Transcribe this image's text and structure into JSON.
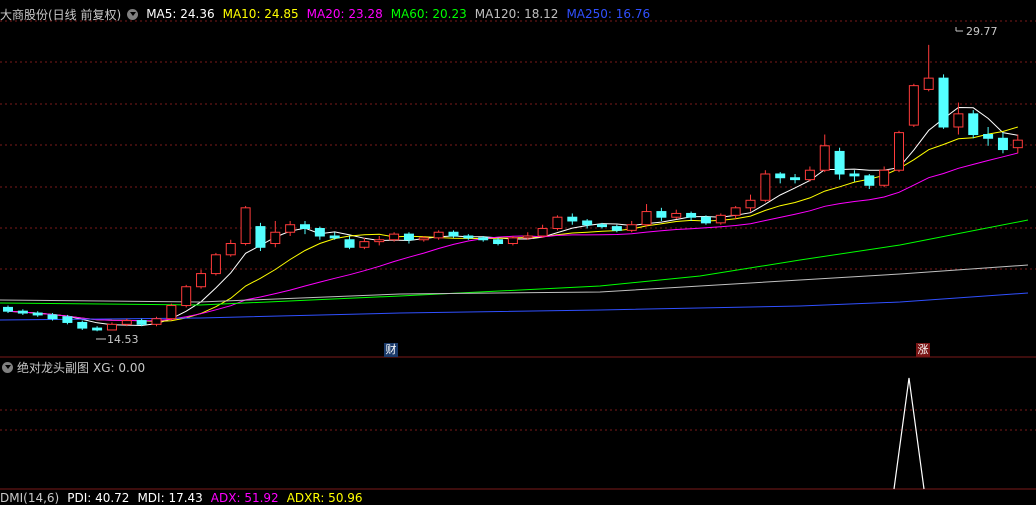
{
  "main_panel": {
    "title": "大商股份(日线 前复权)",
    "ma": [
      {
        "label": "MA5: 24.36",
        "color": "#ffffff"
      },
      {
        "label": "MA10: 24.85",
        "color": "#ffff00"
      },
      {
        "label": "MA20: 23.28",
        "color": "#ff00ff"
      },
      {
        "label": "MA60: 20.23",
        "color": "#00ff00"
      },
      {
        "label": "MA120: 18.12",
        "color": "#c0c0c0"
      },
      {
        "label": "MA250: 16.76",
        "color": "#3050ff"
      }
    ],
    "high_label": "29.77",
    "low_label": "14.53",
    "markers": [
      {
        "text": "财",
        "bg": "#1a3a6a"
      },
      {
        "text": "涨",
        "bg": "#7a1515"
      }
    ]
  },
  "sub_panel": {
    "title": "绝对龙头副图",
    "value": "XG: 0.00"
  },
  "bottom_panel": {
    "items": [
      {
        "label": "DMI(14,6)",
        "color": "#c8c8c8"
      },
      {
        "label": "PDI: 40.72",
        "color": "#ffffff"
      },
      {
        "label": "MDI: 17.43",
        "color": "#ffffff"
      },
      {
        "label": "ADX: 51.92",
        "color": "#ff00ff"
      },
      {
        "label": "ADXR: 50.96",
        "color": "#ffff00"
      }
    ]
  },
  "colors": {
    "up": "#ff3b3b",
    "down": "#54ffff",
    "grid": "#7a1a1a"
  },
  "chart_data": {
    "type": "candlestick",
    "price_high": 29.77,
    "price_low": 14.53,
    "candles": [
      [
        15.8,
        15.6,
        15.9,
        15.5
      ],
      [
        15.6,
        15.5,
        15.7,
        15.4
      ],
      [
        15.5,
        15.4,
        15.6,
        15.3
      ],
      [
        15.4,
        15.2,
        15.5,
        15.1
      ],
      [
        15.3,
        15.0,
        15.4,
        14.9
      ],
      [
        15.0,
        14.7,
        15.1,
        14.6
      ],
      [
        14.7,
        14.6,
        14.8,
        14.53
      ],
      [
        14.6,
        14.9,
        15.0,
        14.6
      ],
      [
        14.9,
        15.1,
        15.2,
        14.8
      ],
      [
        15.1,
        14.9,
        15.2,
        14.8
      ],
      [
        14.9,
        15.2,
        15.3,
        14.8
      ],
      [
        15.2,
        15.9,
        16.0,
        15.1
      ],
      [
        15.9,
        16.9,
        17.0,
        15.8
      ],
      [
        16.9,
        17.6,
        17.8,
        16.8
      ],
      [
        17.6,
        18.6,
        18.7,
        17.5
      ],
      [
        18.6,
        19.2,
        19.4,
        18.5
      ],
      [
        19.2,
        21.1,
        21.2,
        19.1
      ],
      [
        20.1,
        19.0,
        20.3,
        18.8
      ],
      [
        19.2,
        19.8,
        20.4,
        19.0
      ],
      [
        19.8,
        20.2,
        20.4,
        19.6
      ],
      [
        20.2,
        20.0,
        20.4,
        19.7
      ],
      [
        20.0,
        19.6,
        20.1,
        19.4
      ],
      [
        19.6,
        19.5,
        19.8,
        19.4
      ],
      [
        19.4,
        19.0,
        19.6,
        18.9
      ],
      [
        19.0,
        19.3,
        19.5,
        18.9
      ],
      [
        19.3,
        19.4,
        19.6,
        19.1
      ],
      [
        19.4,
        19.7,
        19.8,
        19.3
      ],
      [
        19.7,
        19.4,
        19.8,
        19.2
      ],
      [
        19.4,
        19.5,
        19.6,
        19.3
      ],
      [
        19.5,
        19.8,
        19.9,
        19.4
      ],
      [
        19.8,
        19.6,
        19.9,
        19.5
      ],
      [
        19.6,
        19.5,
        19.7,
        19.4
      ],
      [
        19.5,
        19.4,
        19.6,
        19.3
      ],
      [
        19.4,
        19.2,
        19.5,
        19.1
      ],
      [
        19.2,
        19.5,
        19.6,
        19.1
      ],
      [
        19.5,
        19.6,
        19.8,
        19.4
      ],
      [
        19.6,
        20.0,
        20.2,
        19.5
      ],
      [
        20.0,
        20.6,
        20.7,
        19.9
      ],
      [
        20.6,
        20.4,
        20.8,
        20.2
      ],
      [
        20.4,
        20.2,
        20.5,
        20.0
      ],
      [
        20.2,
        20.1,
        20.3,
        20.0
      ],
      [
        20.1,
        19.9,
        20.2,
        19.8
      ],
      [
        19.9,
        20.2,
        20.4,
        19.8
      ],
      [
        20.2,
        20.9,
        21.3,
        20.1
      ],
      [
        20.9,
        20.6,
        21.1,
        20.4
      ],
      [
        20.6,
        20.8,
        21.0,
        20.5
      ],
      [
        20.8,
        20.6,
        20.9,
        20.4
      ],
      [
        20.6,
        20.3,
        20.7,
        20.2
      ],
      [
        20.3,
        20.7,
        20.8,
        20.2
      ],
      [
        20.7,
        21.1,
        21.2,
        20.5
      ],
      [
        21.1,
        21.5,
        21.8,
        20.9
      ],
      [
        21.5,
        22.9,
        23.1,
        21.4
      ],
      [
        22.9,
        22.7,
        23.0,
        22.4
      ],
      [
        22.7,
        22.6,
        22.9,
        22.4
      ],
      [
        22.6,
        23.1,
        23.3,
        22.5
      ],
      [
        23.1,
        24.4,
        25.0,
        23.0
      ],
      [
        24.1,
        22.9,
        24.3,
        22.6
      ],
      [
        22.9,
        22.8,
        23.1,
        22.5
      ],
      [
        22.8,
        22.3,
        22.9,
        22.1
      ],
      [
        22.3,
        23.1,
        23.3,
        22.2
      ],
      [
        23.1,
        25.1,
        25.2,
        23.0
      ],
      [
        25.5,
        27.6,
        27.7,
        25.4
      ],
      [
        27.4,
        28.0,
        29.77,
        27.3
      ],
      [
        28.0,
        25.4,
        28.2,
        25.3
      ],
      [
        25.4,
        26.1,
        26.7,
        25.0
      ],
      [
        26.1,
        25.0,
        26.3,
        24.8
      ],
      [
        25.0,
        24.8,
        25.4,
        24.4
      ],
      [
        24.8,
        24.2,
        25.1,
        24.0
      ],
      [
        24.3,
        24.7,
        25.0,
        24.0
      ]
    ]
  }
}
